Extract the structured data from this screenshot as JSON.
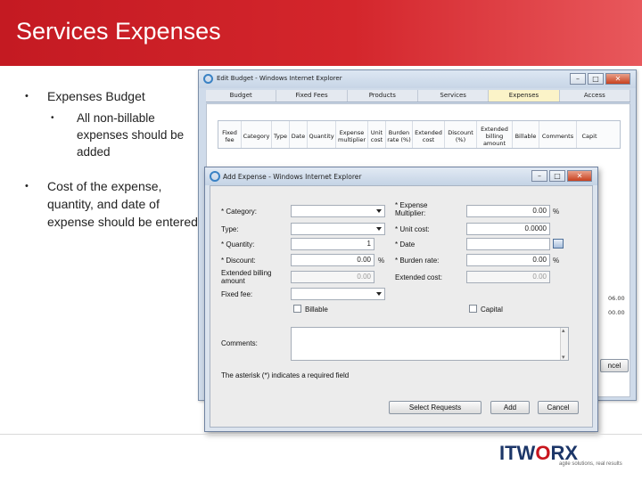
{
  "slide": {
    "title": "Services Expenses",
    "bullets": [
      {
        "text": "Expenses Budget",
        "sub": [
          "All non-billable expenses should be added"
        ]
      },
      {
        "text": "Cost of the expense, quantity, and date of expense should be entered"
      }
    ]
  },
  "back_window": {
    "title": "Edit Budget - Windows Internet Explorer",
    "tabs": [
      "Budget",
      "Fixed Fees",
      "Products",
      "Services",
      "Expenses",
      "Access"
    ],
    "active_tab": "Expenses",
    "grid_headers": [
      "Fixed fee",
      "Category",
      "Type",
      "Date",
      "Quantity",
      "Expense multiplier",
      "Unit cost",
      "Burden rate (%)",
      "Extended cost",
      "Discount (%)",
      "Extended billing amount",
      "Billable",
      "Comments",
      "Capit"
    ],
    "side_values": [
      "06.00",
      "00.00"
    ],
    "partial_button": "ncel"
  },
  "dialog": {
    "title": "Add Expense - Windows Internet Explorer",
    "fields": {
      "category_label": "* Category:",
      "type_label": "Type:",
      "quantity_label": "* Quantity:",
      "quantity_value": "1",
      "discount_label": "* Discount:",
      "discount_value": "0.00",
      "discount_unit": "%",
      "ext_billing_label": "Extended billing amount",
      "ext_billing_value": "0.00",
      "fixed_fee_label": "Fixed fee:",
      "billable_label": "Billable",
      "expense_mult_label": "* Expense Multiplier:",
      "expense_mult_value": "0.00",
      "expense_mult_unit": "%",
      "unit_cost_label": "* Unit cost:",
      "unit_cost_value": "0.0000",
      "date_label": "* Date",
      "burden_rate_label": "* Burden rate:",
      "burden_rate_value": "0.00",
      "burden_rate_unit": "%",
      "extended_cost_label": "Extended cost:",
      "extended_cost_value": "0.00",
      "capital_label": "Capital",
      "comments_label": "Comments:"
    },
    "note": "The asterisk (*) indicates a required field",
    "buttons": {
      "select_requests": "Select Requests",
      "add": "Add",
      "cancel": "Cancel"
    }
  },
  "logo": {
    "text_a": "ITW",
    "text_b": "O",
    "text_c": "RX",
    "tagline": "agile solutions, real results"
  },
  "colors": {
    "header_red": "#c41a22",
    "logo_blue": "#1c3668",
    "logo_red": "#c8151d",
    "active_tab": "#fbf3c8"
  }
}
